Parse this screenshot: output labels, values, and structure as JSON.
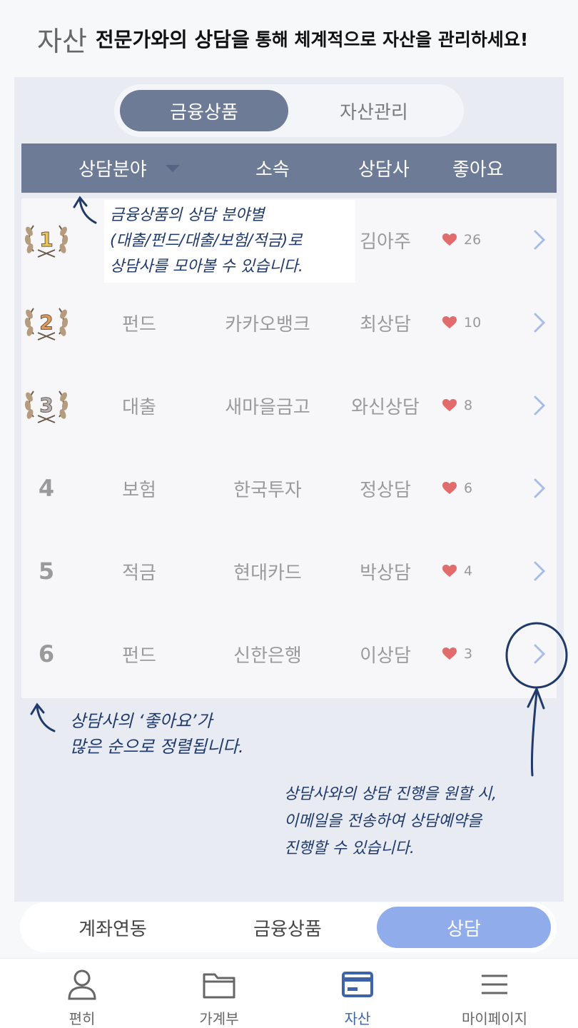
{
  "header": {
    "word": "자산",
    "strong": "전문가와의 상담을",
    "rest": "통해 체계적으로 자산을 관리하세요!"
  },
  "segment": {
    "active": "금융상품",
    "inactive": "자산관리"
  },
  "table": {
    "headers": {
      "field": "상담분야",
      "org": "소속",
      "counsel": "상담사",
      "likes": "좋아요"
    },
    "rows": [
      {
        "rank": "1",
        "field": "",
        "org": "",
        "counsel": "김아주",
        "likes": "26",
        "medal": "gold"
      },
      {
        "rank": "2",
        "field": "펀드",
        "org": "카카오뱅크",
        "counsel": "최상담",
        "likes": "10",
        "medal": "bronze"
      },
      {
        "rank": "3",
        "field": "대출",
        "org": "새마을금고",
        "counsel": "와신상담",
        "likes": "8",
        "medal": "silver"
      },
      {
        "rank": "4",
        "field": "보험",
        "org": "한국투자",
        "counsel": "정상담",
        "likes": "6"
      },
      {
        "rank": "5",
        "field": "적금",
        "org": "현대카드",
        "counsel": "박상담",
        "likes": "4"
      },
      {
        "rank": "6",
        "field": "펀드",
        "org": "신한은행",
        "counsel": "이상담",
        "likes": "3"
      }
    ]
  },
  "annotations": {
    "note1_line1": "금융상품의 상담 분야별",
    "note1_line2": "(대출/펀드/대출/보험/적금)로",
    "note1_line3": "상담사를 모아볼 수 있습니다.",
    "note2_line1": "상담사의 ‘좋아요’가",
    "note2_line2": "많은 순으로 정렬됩니다.",
    "note3_line1": "상담사와의 상담 진행을 원할 시,",
    "note3_line2": "이메일을 전송하여 상담예약을",
    "note3_line3": "진행할 수 있습니다."
  },
  "subtabs": [
    "계좌연동",
    "금융상품",
    "상담"
  ],
  "bottom_nav": [
    "편히",
    "가계부",
    "자산",
    "마이페이지"
  ],
  "colors": {
    "accent": "#6d7b96",
    "subtab_active": "#90acea",
    "heart": "#e26b6b",
    "arrow": "#a9bde6",
    "nav_active": "#3d64a8",
    "annotation": "#1f3a6b"
  }
}
